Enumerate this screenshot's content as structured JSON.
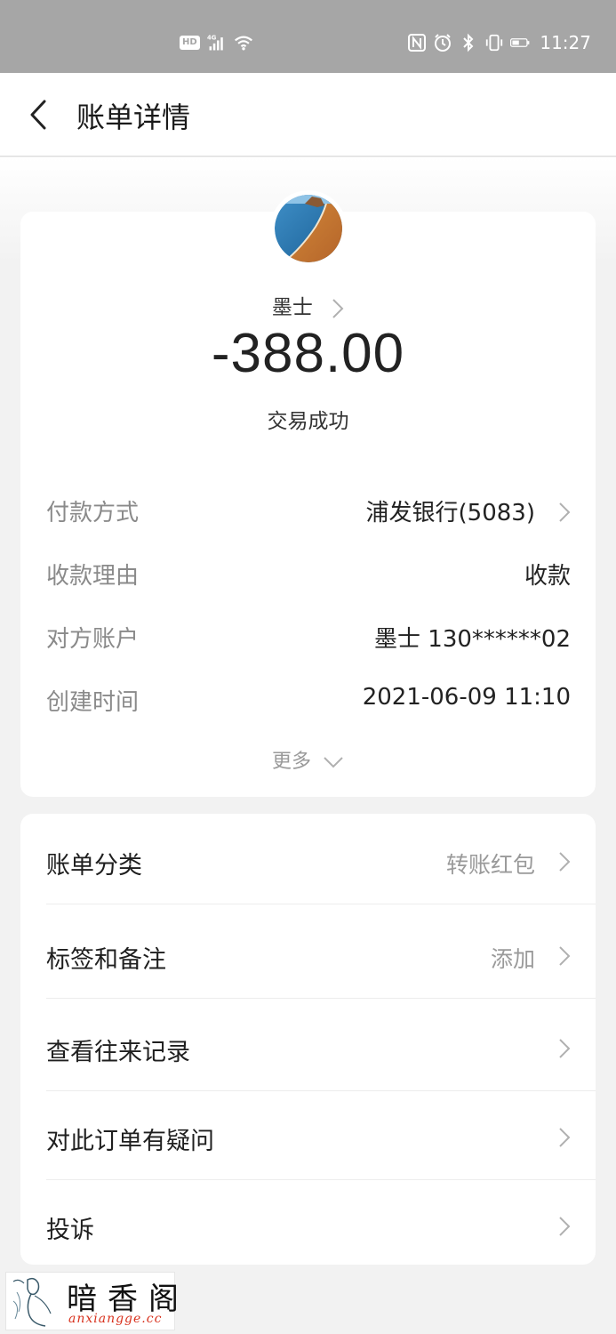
{
  "status_bar": {
    "hd_badge": "HD",
    "network": "4G",
    "time": "11:27"
  },
  "header": {
    "title": "账单详情"
  },
  "transaction": {
    "payee": "墨士",
    "amount": "-388.00",
    "status": "交易成功"
  },
  "details": [
    {
      "label": "付款方式",
      "value": "浦发银行(5083)"
    },
    {
      "label": "收款理由",
      "value": "收款"
    },
    {
      "label": "对方账户",
      "value": "墨士 130******02"
    },
    {
      "label": "创建时间",
      "value": "2021-06-09 11:10"
    }
  ],
  "more_label": "更多",
  "menu": [
    {
      "label": "账单分类",
      "value": "转账红包"
    },
    {
      "label": "标签和备注",
      "value": "添加"
    },
    {
      "label": "查看往来记录",
      "value": ""
    },
    {
      "label": "对此订单有疑问",
      "value": ""
    },
    {
      "label": "投诉",
      "value": ""
    }
  ],
  "watermark": {
    "name": "暗香阁",
    "url": "anxiangge.cc"
  },
  "colors": {
    "status_bar_bg": "#a6a6a6",
    "page_bg": "#f2f2f2",
    "card_bg": "#ffffff",
    "label_gray": "#8a8a8a",
    "watermark_url": "#d8321e"
  }
}
